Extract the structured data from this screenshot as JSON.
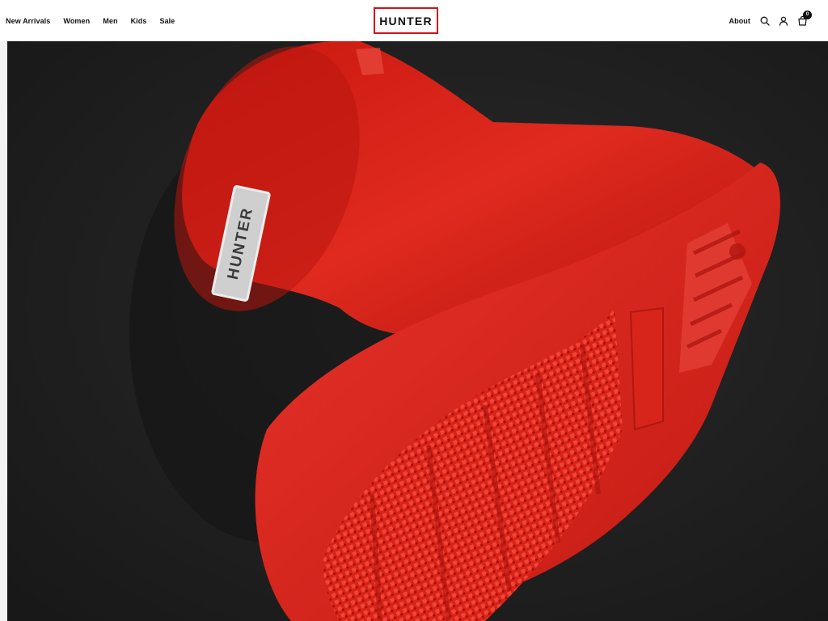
{
  "header": {
    "nav_left": [
      {
        "label": "New Arrivals"
      },
      {
        "label": "Women"
      },
      {
        "label": "Men"
      },
      {
        "label": "Kids"
      },
      {
        "label": "Sale"
      }
    ],
    "logo": {
      "text": "HUNTER",
      "border_color": "#d1121b"
    },
    "nav_right": {
      "about_label": "About",
      "search_icon": "search-icon",
      "account_icon": "user-icon",
      "cart_icon": "shopping-bag-icon",
      "cart_count": "0"
    }
  },
  "hero": {
    "image_subject": "red rubber boot sole",
    "boot_label_text": "HUNTER",
    "background_color": "#1f1f1f",
    "boot_color": "#d8221a"
  }
}
